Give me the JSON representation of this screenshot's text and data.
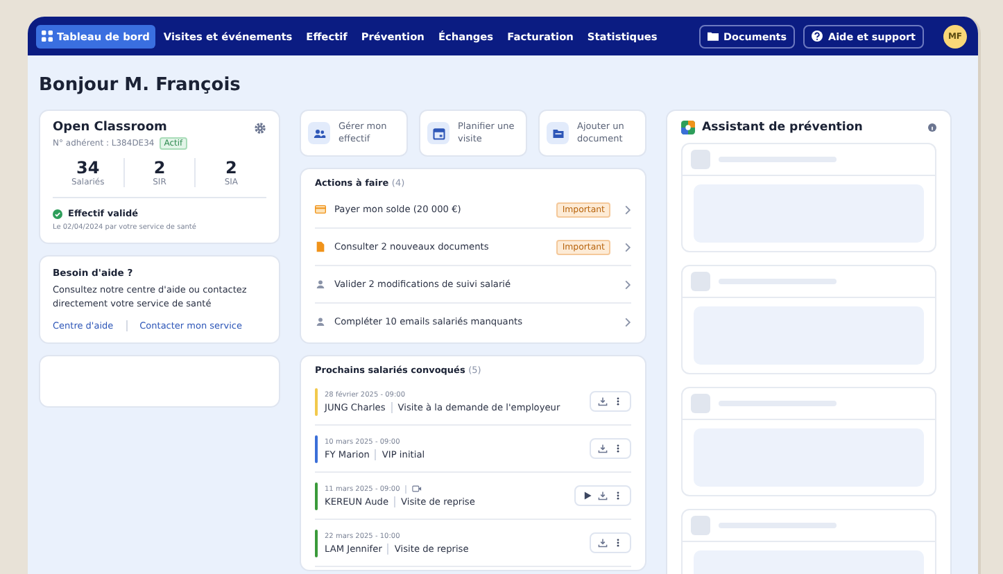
{
  "nav": {
    "items": [
      {
        "label": "Tableau de bord",
        "selected": true
      },
      {
        "label": "Visites et événements",
        "selected": false
      },
      {
        "label": "Effectif",
        "selected": false
      },
      {
        "label": "Prévention",
        "selected": false
      },
      {
        "label": "Échanges",
        "selected": false
      },
      {
        "label": "Facturation",
        "selected": false
      },
      {
        "label": "Statistiques",
        "selected": false
      }
    ],
    "documents": "Documents",
    "help": "Aide et support",
    "avatar": "MF"
  },
  "greeting": "Bonjour M. François",
  "company": {
    "name": "Open Classroom",
    "member": "N° adhérent : L384DE34",
    "status": "Actif",
    "stats": [
      {
        "value": "34",
        "label": "Salariés"
      },
      {
        "value": "2",
        "label": "SIR"
      },
      {
        "value": "2",
        "label": "SIA"
      }
    ],
    "validation": "Effectif validé",
    "validation_note": "Le 02/04/2024 par votre service de santé"
  },
  "help_card": {
    "title": "Besoin d'aide ?",
    "text": "Consultez notre centre d'aide ou contactez directement votre service de santé",
    "links": [
      "Centre d'aide",
      "Contacter mon service"
    ]
  },
  "quick_actions": [
    {
      "kind": "people",
      "label": "Gérer mon effectif"
    },
    {
      "kind": "calendar",
      "label": "Planifier une visite"
    },
    {
      "kind": "folder",
      "label": "Ajouter un document"
    }
  ],
  "todo": {
    "title": "Actions à faire",
    "count": "(4)",
    "items": [
      {
        "kind": "payment",
        "label": "Payer mon solde (20 000 €)",
        "badge": "Important"
      },
      {
        "kind": "document",
        "label": "Consulter 2 nouveaux documents",
        "badge": "Important"
      },
      {
        "kind": "person",
        "label": "Valider 2 modifications de suivi salarié"
      },
      {
        "kind": "person",
        "label": "Compléter 10 emails salariés manquants"
      }
    ]
  },
  "convocations": {
    "title": "Prochains salariés convoqués",
    "count": "(5)",
    "items": [
      {
        "date": "28 février 2025 - 09:00",
        "name": "JUNG Charles",
        "type": "Visite à la demande de l'employeur",
        "color": "#f2c94c",
        "video": false
      },
      {
        "date": "10 mars 2025 - 09:00",
        "name": "FY Marion",
        "type": "VIP initial",
        "color": "#3b6fd8",
        "video": false
      },
      {
        "date": "11 mars 2025 - 09:00",
        "name": "KEREUN Aude",
        "type": "Visite de reprise",
        "color": "#3a9a3a",
        "video": true
      },
      {
        "date": "22 mars 2025 - 10:00",
        "name": "LAM Jennifer",
        "type": "Visite de reprise",
        "color": "#3a9a3a",
        "video": false
      }
    ]
  },
  "assistant": {
    "title": "Assistant de prévention"
  }
}
